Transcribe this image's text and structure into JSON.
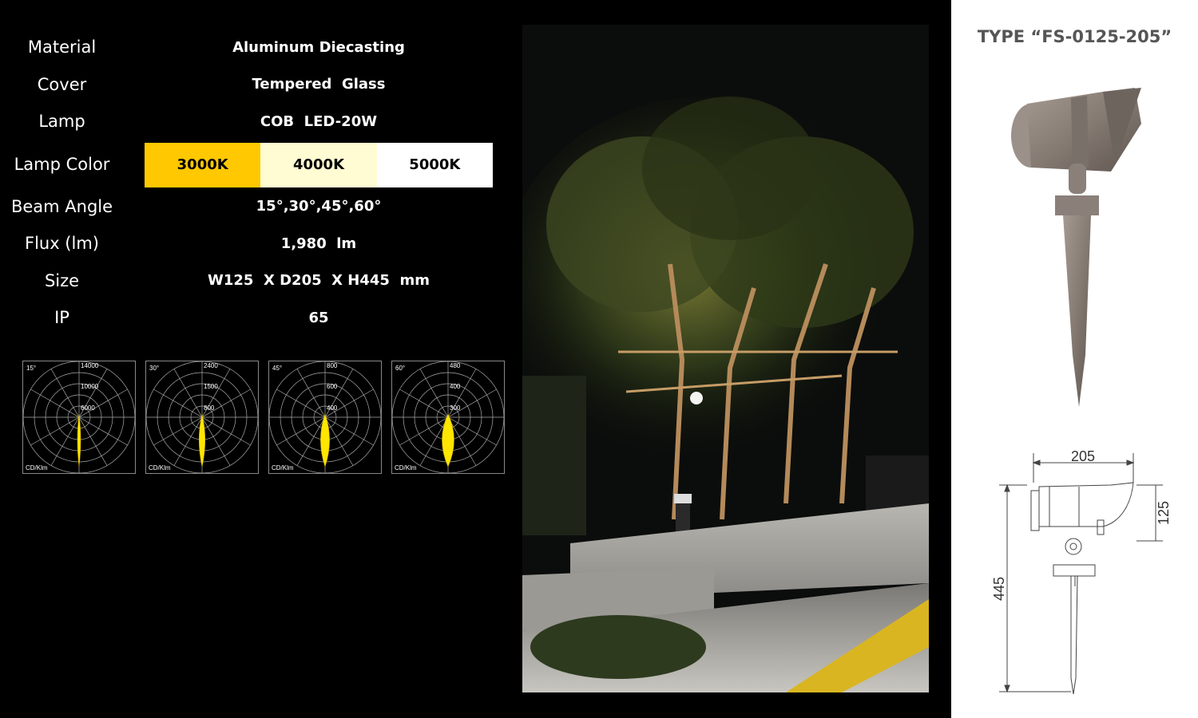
{
  "specs": [
    {
      "label": "Material",
      "value": "Aluminum Diecasting"
    },
    {
      "label": "Cover",
      "value": "Tempered  Glass"
    },
    {
      "label": "Lamp",
      "value": "COB  LED-20W"
    },
    {
      "label": "Lamp Color",
      "options": [
        "3000K",
        "4000K",
        "5000K"
      ]
    },
    {
      "label": "Beam Angle",
      "value": "15°,30°,45°,60°"
    },
    {
      "label": "Flux (lm)",
      "value": "1,980  lm"
    },
    {
      "label": "Size",
      "value": "W125  X D205  X H445  mm"
    },
    {
      "label": "IP",
      "value": "65"
    }
  ],
  "colors": {
    "3000K": "#ffc800",
    "4000K": "#fffbd2",
    "5000K": "#ffffff",
    "beam": "#ffe600"
  },
  "polar_charts": [
    {
      "angle": "15°",
      "rings": [
        "14000",
        "10000",
        "6000"
      ],
      "unit": "CD/Klm",
      "beam_angle_deg": 15
    },
    {
      "angle": "30°",
      "rings": [
        "2400",
        "1500",
        "800"
      ],
      "unit": "CD/Klm",
      "beam_angle_deg": 30
    },
    {
      "angle": "45°",
      "rings": [
        "800",
        "600",
        "400"
      ],
      "unit": "CD/Klm",
      "beam_angle_deg": 45
    },
    {
      "angle": "60°",
      "rings": [
        "480",
        "400",
        "300"
      ],
      "unit": "CD/Klm",
      "beam_angle_deg": 60
    }
  ],
  "product": {
    "type_title": "TYPE “FS-0125-205”",
    "dims": {
      "width": "205",
      "head_height": "125",
      "total_height": "445"
    }
  }
}
